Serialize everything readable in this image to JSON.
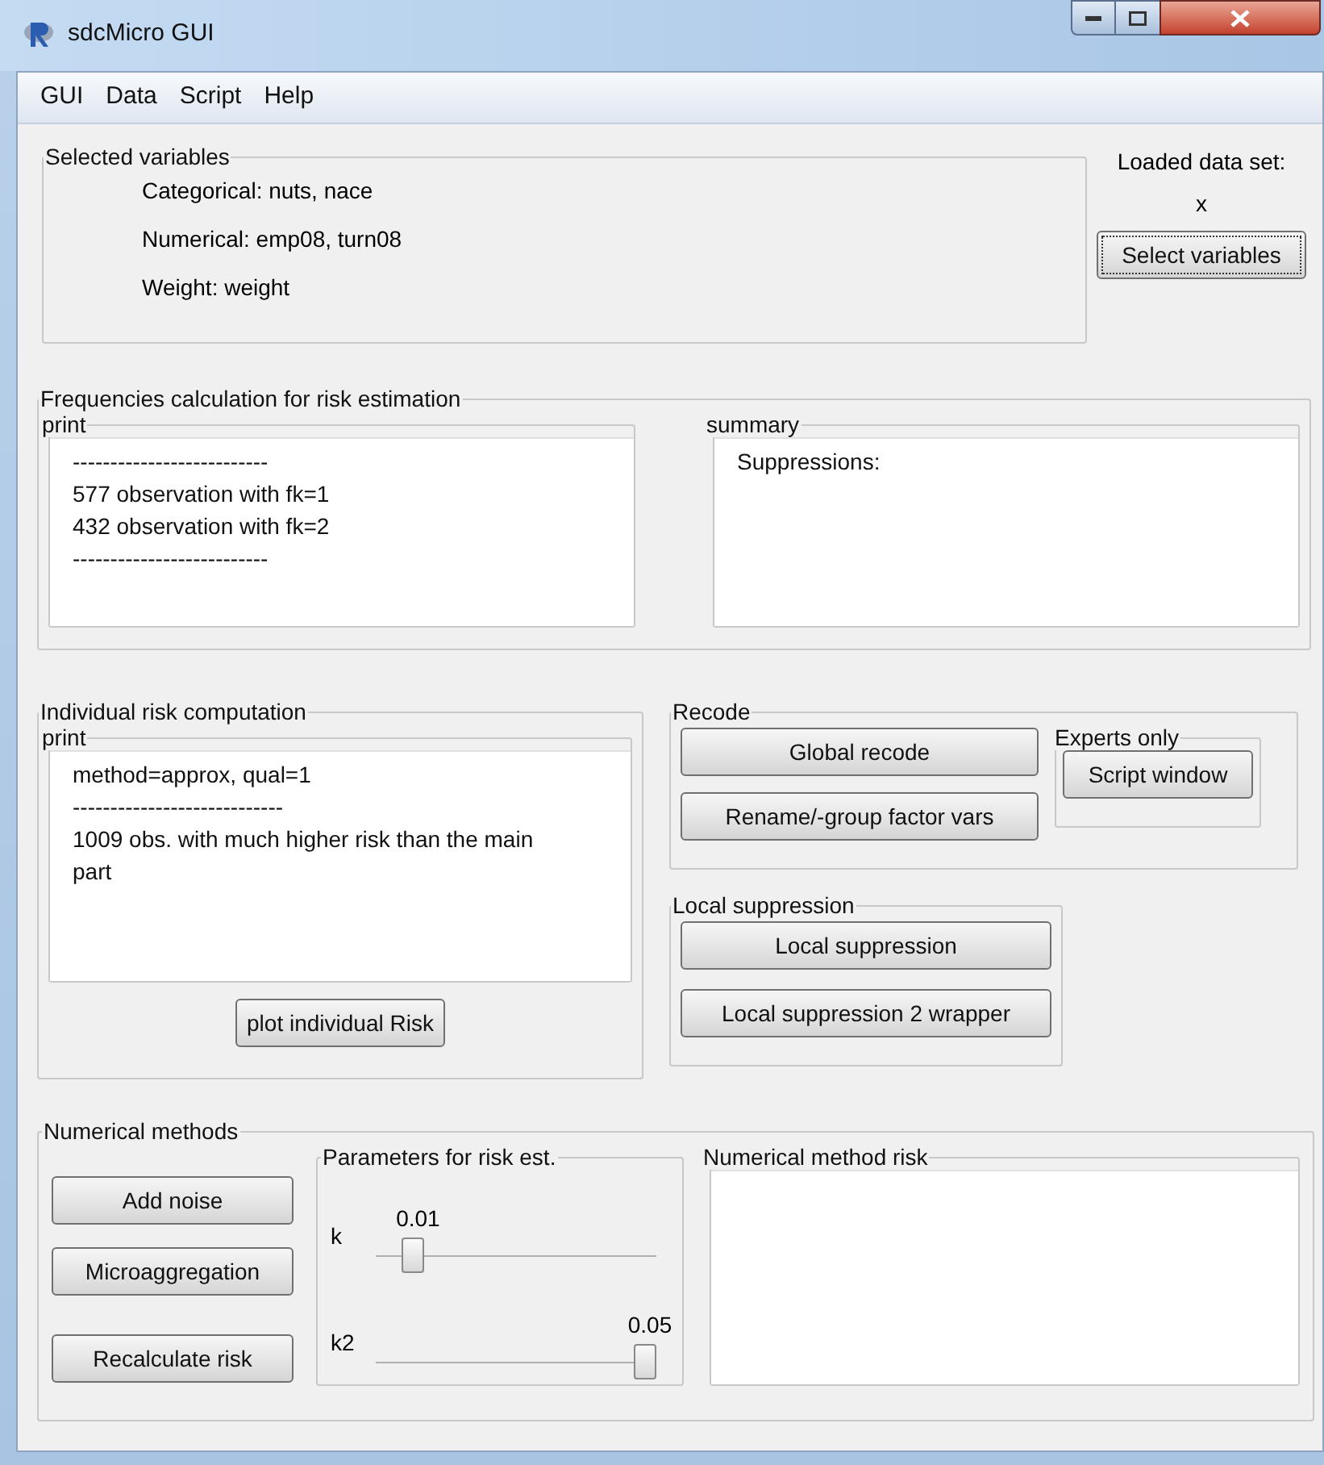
{
  "window": {
    "title": "sdcMicro GUI"
  },
  "menu": [
    "GUI",
    "Data",
    "Script",
    "Help"
  ],
  "selected_variables": {
    "title": "Selected variables",
    "lines": [
      "Categorical: nuts, nace",
      "Numerical: emp08, turn08",
      "Weight: weight"
    ]
  },
  "loaded_data": {
    "label": "Loaded data set:",
    "value": "x",
    "button": "Select variables"
  },
  "frequencies": {
    "title": "Frequencies calculation for risk estimation",
    "print": {
      "title": "print",
      "lines": [
        "--------------------------",
        "577 observation with fk=1",
        "432 observation with fk=2",
        "--------------------------"
      ]
    },
    "summary": {
      "title": "summary",
      "lines": [
        "Suppressions:"
      ]
    }
  },
  "individual_risk": {
    "title": "Individual risk computation",
    "print": {
      "title": "print",
      "lines": [
        "method=approx, qual=1",
        "----------------------------",
        "1009 obs. with much higher risk than the main part"
      ]
    },
    "button": "plot individual Risk"
  },
  "recode": {
    "title": "Recode",
    "buttons": [
      "Global recode",
      "Rename/-group factor vars"
    ],
    "experts": {
      "title": "Experts only",
      "button": "Script window"
    }
  },
  "local_suppression": {
    "title": "Local suppression",
    "buttons": [
      "Local suppression",
      "Local suppression 2 wrapper"
    ]
  },
  "numerical_methods": {
    "title": "Numerical methods",
    "buttons": [
      "Add noise",
      "Microaggregation",
      "Recalculate risk"
    ],
    "parameters": {
      "title": "Parameters for risk est.",
      "sliders": [
        {
          "label": "k",
          "reading": "0.01",
          "level": 0.1
        },
        {
          "label": "k2",
          "reading": "0.05",
          "level": 1
        }
      ]
    },
    "risk": {
      "title": "Numerical method risk"
    }
  }
}
